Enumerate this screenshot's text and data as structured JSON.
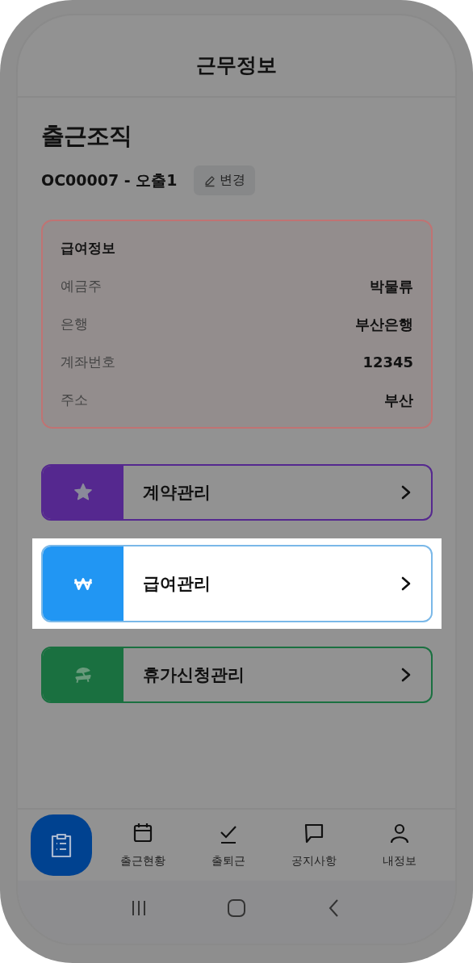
{
  "header": {
    "title": "근무정보"
  },
  "organization": {
    "heading": "출근조직",
    "code": "OC00007 - 오출1",
    "change_button": "변경"
  },
  "salary_info": {
    "title": "급여정보",
    "rows": [
      {
        "label": "예금주",
        "value": "박물류"
      },
      {
        "label": "은행",
        "value": "부산은행"
      },
      {
        "label": "계좌번호",
        "value": "12345"
      },
      {
        "label": "주소",
        "value": "부산"
      }
    ]
  },
  "menu": [
    {
      "label": "계약관리",
      "kind": "star",
      "color": "#55288f",
      "highlighted": false
    },
    {
      "label": "급여관리",
      "kind": "won",
      "color": "#2196f3",
      "highlighted": true
    },
    {
      "label": "휴가신청관리",
      "kind": "beach",
      "color": "#1a7040",
      "highlighted": false
    }
  ],
  "bottom_nav": [
    {
      "label": "출근현황",
      "kind": "calendar"
    },
    {
      "label": "출퇴근",
      "kind": "check"
    },
    {
      "label": "공지사항",
      "kind": "chat"
    },
    {
      "label": "내정보",
      "kind": "person"
    }
  ]
}
